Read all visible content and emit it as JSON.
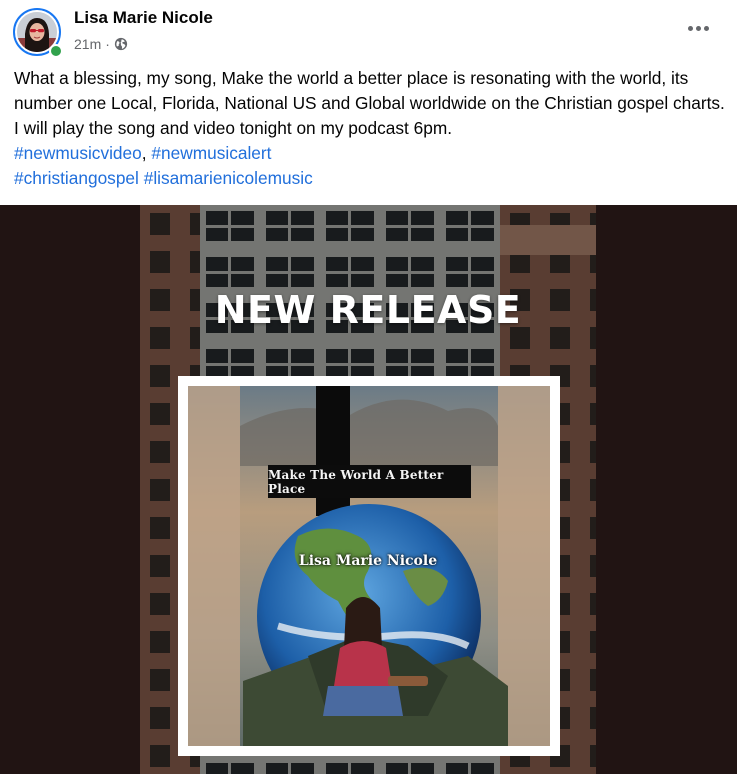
{
  "post": {
    "author": "Lisa Marie Nicole",
    "time": "21m",
    "separator": "·",
    "privacy_icon": "globe-icon",
    "more_icon": "more-options-icon",
    "online_status_color": "#31a24c",
    "body": {
      "text": "What a blessing, my song, Make the world a better place is resonating with the world, its number one Local, Florida, National US and Global worldwide on the Christian gospel charts. I will play the song and video tonight on my podcast 6pm.",
      "hashtags_line1": [
        "#newmusicvideo",
        "#newmusicalert"
      ],
      "hashtag_separator": ",",
      "hashtags_line2": [
        "#christiangospel",
        "#lisamarienicolemusic"
      ],
      "link_color": "#216fdb"
    }
  },
  "media": {
    "headline": "NEW RELEASE",
    "cover_title": "Make The World A Better Place",
    "cover_artist": "Lisa Marie Nicole"
  }
}
